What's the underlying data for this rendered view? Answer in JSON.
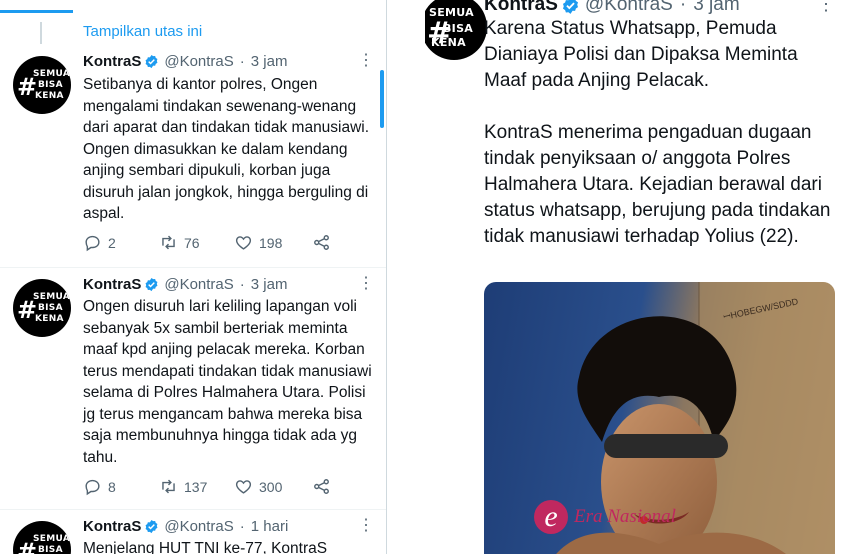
{
  "left": {
    "show_thread": "Tampilkan utas ini",
    "avatar_text": [
      "SEMUA",
      "BISA",
      "KENA"
    ],
    "tweets": [
      {
        "name": "KontraS",
        "handle": "@KontraS",
        "sep": "·",
        "time": "3 jam",
        "text": "Setibanya di kantor polres, Ongen mengalami tindakan sewenang-wenang dari aparat dan tindakan tidak manusiawi. Ongen dimasukkan ke dalam kendang anjing sembari dipukuli, korban juga disuruh jalan jongkok, hingga berguling di aspal.",
        "replies": "2",
        "retweets": "76",
        "likes": "198"
      },
      {
        "name": "KontraS",
        "handle": "@KontraS",
        "sep": "·",
        "time": "3 jam",
        "text": "Ongen disuruh lari keliling lapangan voli sebanyak 5x sambil berteriak meminta maaf kpd anjing pelacak mereka. Korban terus mendapati tindakan tidak manusiawi selama di Polres Halmahera Utara. Polisi jg terus mengancam bahwa mereka bisa saja membunuhnya hingga tidak ada yg tahu.",
        "replies": "8",
        "retweets": "137",
        "likes": "300"
      },
      {
        "name": "KontraS",
        "handle": "@KontraS",
        "sep": "·",
        "time": "1 hari",
        "text": "Menjelang HUT TNI ke-77, KontraS"
      }
    ]
  },
  "right": {
    "name": "KontraS",
    "handle": "@KontraS",
    "sep": "·",
    "time": "3 jam",
    "paragraph1": "Karena Status Whatsapp, Pemuda Dianiaya Polisi dan Dipaksa Meminta Maaf pada Anjing Pelacak.",
    "paragraph2": "KontraS menerima pengaduan dugaan tindak penyiksaan o/ anggota Polres Halmahera Utara. Kejadian berawal dari status whatsapp, berujung pada tindakan tidak manusiawi terhadap Yolius (22).",
    "photo_scrawl": "ꟷHOBEGW/SDDD",
    "watermark": "Era Nasional"
  },
  "colors": {
    "accent": "#1d9bf0",
    "muted": "#536471",
    "text": "#0f1419"
  }
}
